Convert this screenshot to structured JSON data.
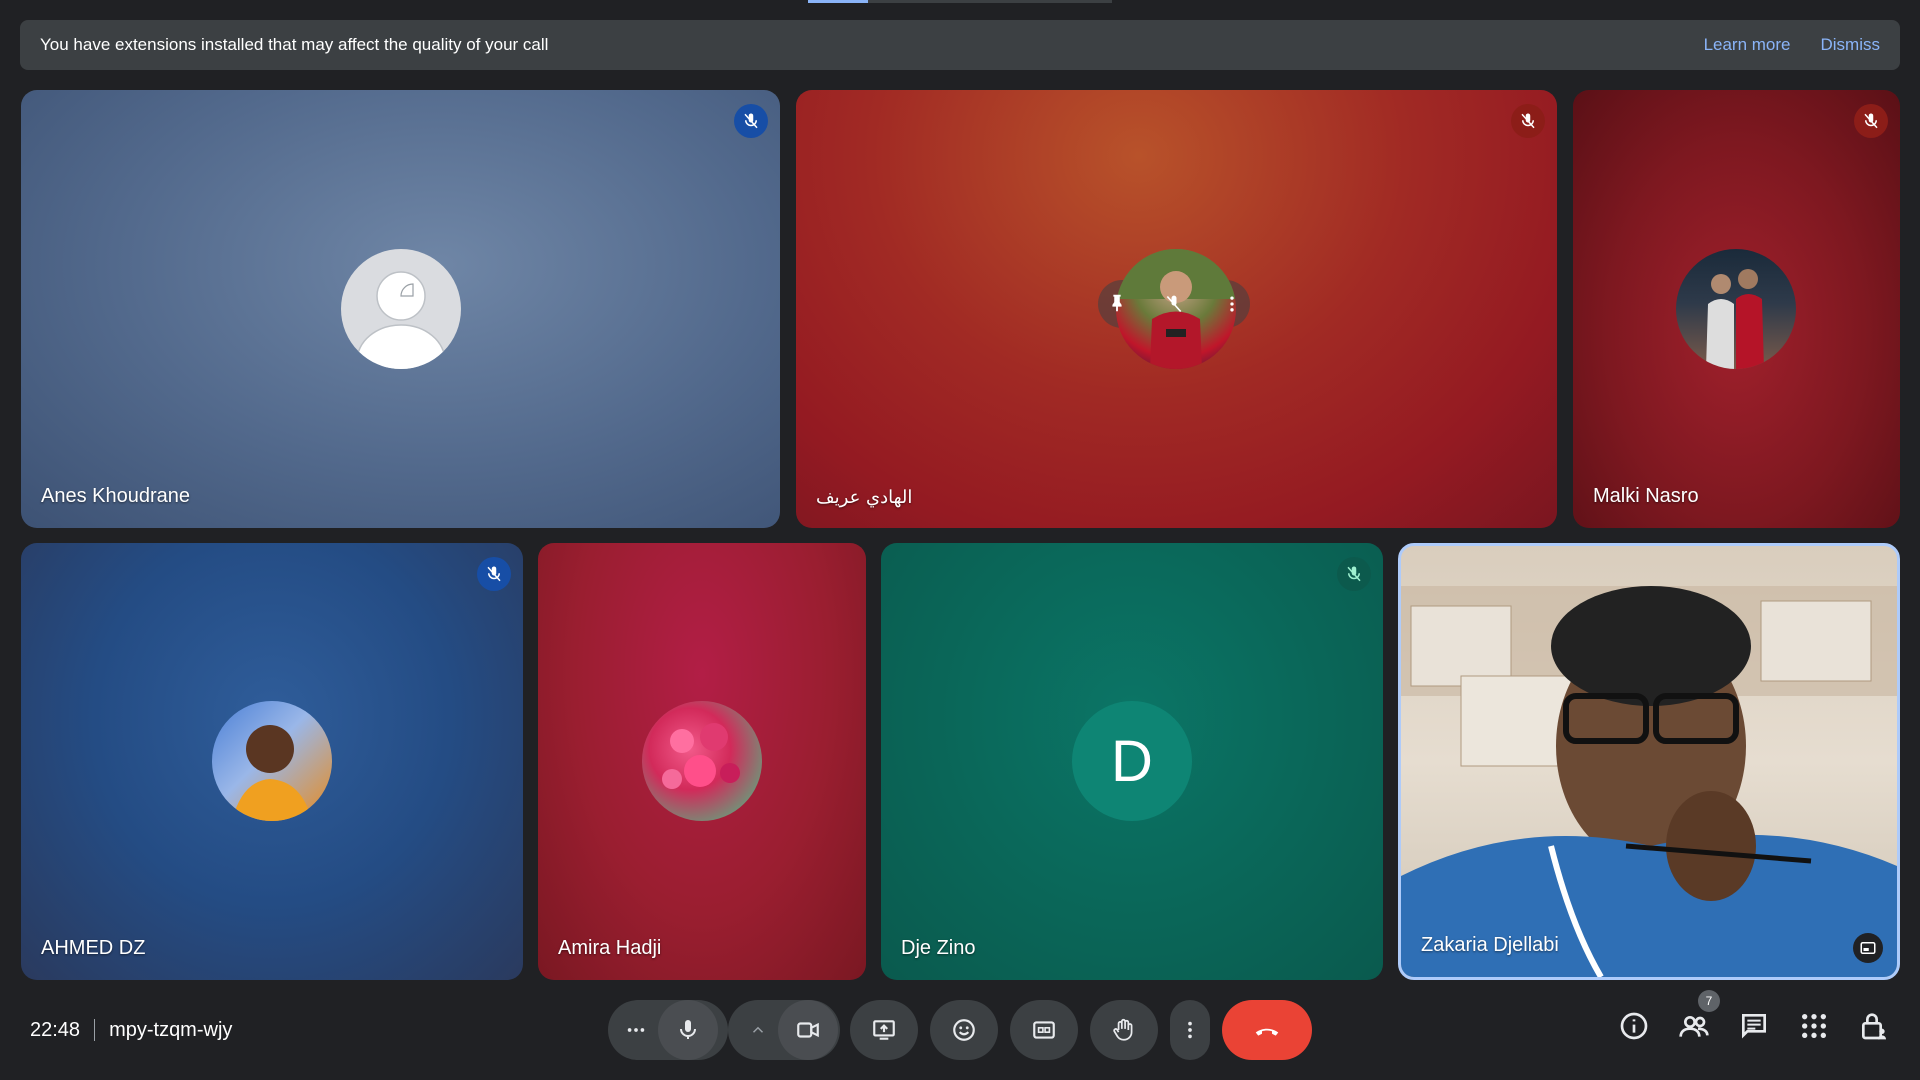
{
  "banner": {
    "message": "You have extensions installed that may affect the quality of your call",
    "learn_more": "Learn more",
    "dismiss": "Dismiss"
  },
  "participants": [
    {
      "name": "Anes Khoudrane",
      "muted": true,
      "avatar": "default-avatar-icon"
    },
    {
      "name": "الهادي عريف",
      "muted": true,
      "avatar": "photo"
    },
    {
      "name": "Malki Nasro",
      "muted": true,
      "avatar": "photo"
    },
    {
      "name": "AHMED DZ",
      "muted": true,
      "avatar": "photo"
    },
    {
      "name": "Amira Hadji",
      "muted": false,
      "avatar": "photo"
    },
    {
      "name": "Dje Zino",
      "muted": true,
      "avatar_letter": "D"
    },
    {
      "name": "Zakaria Djellabi",
      "muted": false,
      "avatar": "camera-feed"
    }
  ],
  "footer": {
    "time": "22:48",
    "meeting_code": "mpy-tzqm-wjy",
    "people_count": "7"
  },
  "colors": {
    "background": "#202124",
    "banner": "#3c4043",
    "link": "#8ab4f8",
    "end_call": "#ea4335",
    "dje_tile": "#0b6b5c"
  }
}
